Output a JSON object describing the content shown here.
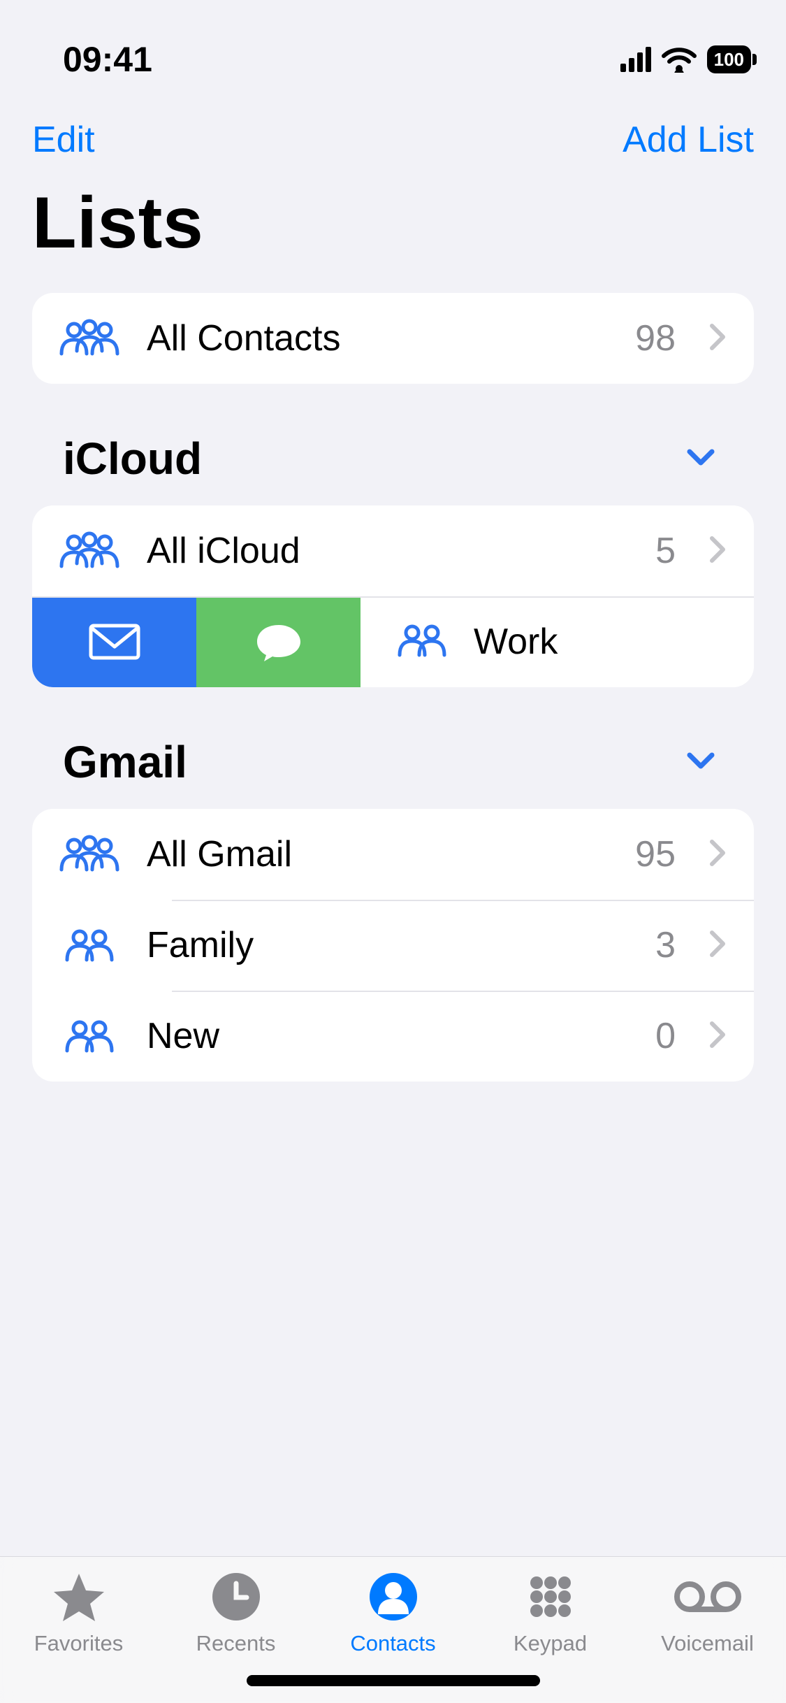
{
  "status": {
    "time": "09:41",
    "battery": "100"
  },
  "nav": {
    "edit": "Edit",
    "add": "Add List"
  },
  "title": "Lists",
  "top": {
    "all_contacts": {
      "label": "All Contacts",
      "count": "98"
    }
  },
  "sections": {
    "icloud": {
      "title": "iCloud",
      "all": {
        "label": "All iCloud",
        "count": "5"
      },
      "work": {
        "label": "Work"
      }
    },
    "gmail": {
      "title": "Gmail",
      "all": {
        "label": "All Gmail",
        "count": "95"
      },
      "family": {
        "label": "Family",
        "count": "3"
      },
      "new": {
        "label": "New",
        "count": "0"
      }
    }
  },
  "tabs": {
    "favorites": "Favorites",
    "recents": "Recents",
    "contacts": "Contacts",
    "keypad": "Keypad",
    "voicemail": "Voicemail"
  }
}
